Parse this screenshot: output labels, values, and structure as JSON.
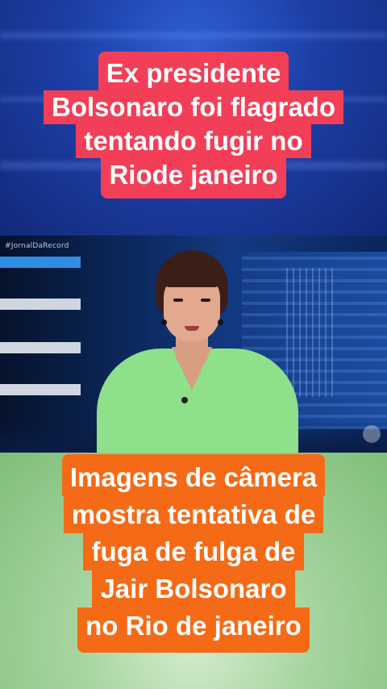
{
  "caption_top": {
    "lines": [
      "Ex presidente",
      "Bolsonaro foi flagrado",
      "tentando fugir no",
      "Riode janeiro"
    ],
    "background": "#f23f57"
  },
  "video": {
    "hashtag": "#JornalDaRecord"
  },
  "caption_bottom": {
    "lines": [
      "Imagens de câmera",
      "mostra tentativa de",
      "fuga de fulga de",
      "Jair Bolsonaro",
      "no Rio de janeiro"
    ],
    "background": "#f56a16"
  },
  "colors": {
    "top_background": "#1c3fa6",
    "bottom_background": "#a9d6a2",
    "shirt": "#8fe08a"
  }
}
